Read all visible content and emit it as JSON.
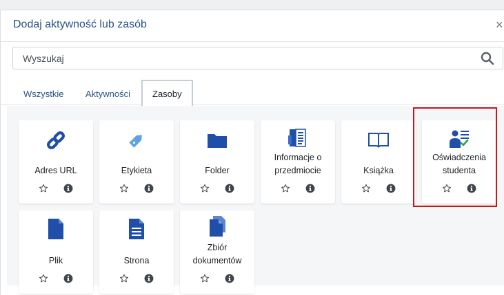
{
  "modal": {
    "title": "Dodaj aktywność lub zasób",
    "close": "×"
  },
  "search": {
    "placeholder": "Wyszukaj",
    "value": ""
  },
  "tabs": [
    {
      "label": "Wszystkie",
      "active": false
    },
    {
      "label": "Aktywności",
      "active": false
    },
    {
      "label": "Zasoby",
      "active": true
    }
  ],
  "items": [
    {
      "label": "Adres URL",
      "icon": "link-icon"
    },
    {
      "label": "Etykieta",
      "icon": "tag-icon"
    },
    {
      "label": "Folder",
      "icon": "folder-icon"
    },
    {
      "label": "Informacje o przedmiocie",
      "icon": "course-info-icon"
    },
    {
      "label": "Książka",
      "icon": "book-icon"
    },
    {
      "label": "Oświadczenia studenta",
      "icon": "student-declaration-icon"
    },
    {
      "label": "Plik",
      "icon": "file-icon"
    },
    {
      "label": "Strona",
      "icon": "page-icon"
    },
    {
      "label": "Zbiór dokumentów",
      "icon": "document-collection-icon"
    }
  ],
  "colors": {
    "accent": "#2b5285",
    "icon_blue": "#1f4fa8",
    "highlight": "#c0191e"
  }
}
